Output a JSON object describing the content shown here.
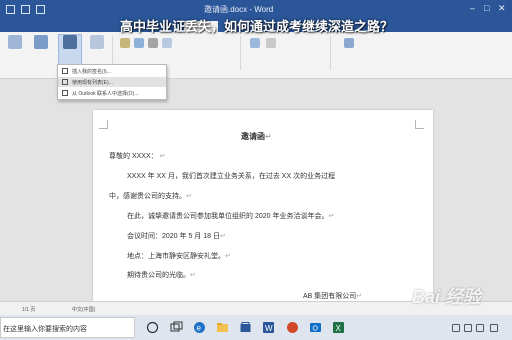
{
  "headline": "高中毕业证丢失，如何通过成考继续深造之路？",
  "window": {
    "title": "邀请函.docx - Word"
  },
  "menu": {
    "items": [
      {
        "label": "插入我的签名(I)..."
      },
      {
        "label": "使用现有列表(E)..."
      },
      {
        "label": "从 Outlook 联系人中选择(O)..."
      }
    ]
  },
  "document": {
    "title": "邀请函",
    "salutation": "尊敬的 XXXX：",
    "body1": "XXXX 年 XX 月，我们首次建立业务关系，在过去 XX 次的业务过程",
    "body1_cont": "中，感谢贵公司的支持。",
    "body2": "在此，诚挚邀请贵公司参加我单位组织的 2020 年业务洽谈年会。",
    "meeting_time": "会议时间：2020 年 5 月 18 日",
    "location": "地点：上海市静安区静安礼堂。",
    "closing": "期待贵公司的光临。",
    "signature": "AB 集团有限公司",
    "paragraph_mark": "↵"
  },
  "statusbar": {
    "page": "1/1 页",
    "language": "中文(中国)"
  },
  "taskbar": {
    "search_placeholder": "在这里输入你要搜索的内容"
  },
  "watermark": "Bai 经验"
}
